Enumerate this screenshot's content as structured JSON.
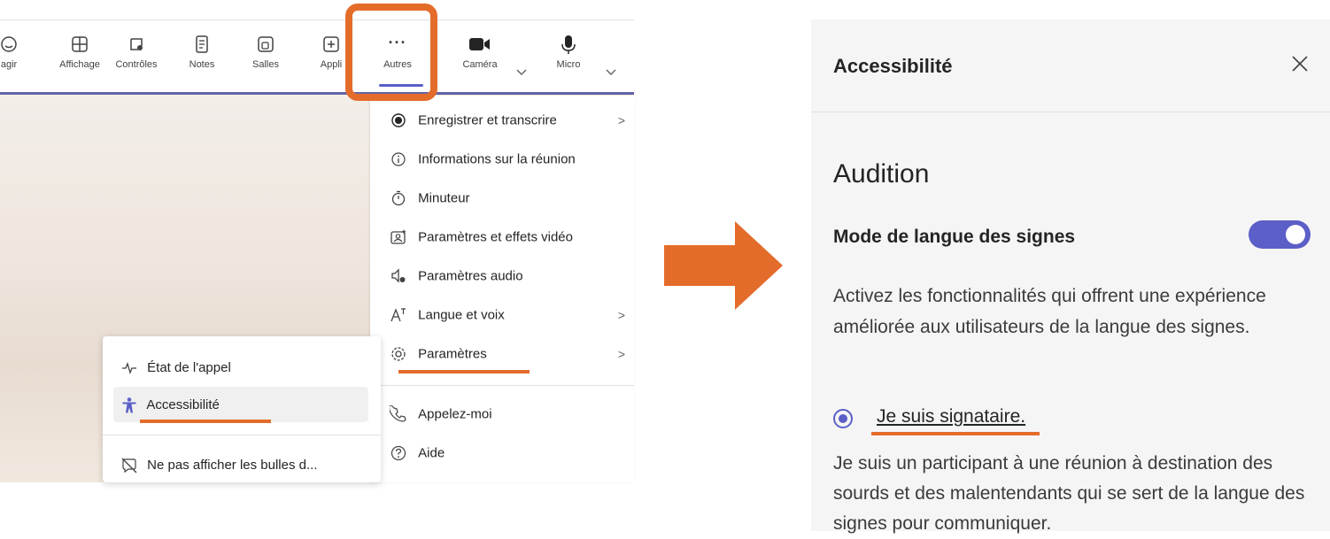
{
  "toolbar": {
    "items": [
      {
        "label": "agir",
        "icon": "react-icon"
      },
      {
        "label": "Affichage",
        "icon": "view-icon"
      },
      {
        "label": "Contrôles",
        "icon": "controls-icon"
      },
      {
        "label": "Notes",
        "icon": "notes-icon"
      },
      {
        "label": "Salles",
        "icon": "rooms-icon"
      },
      {
        "label": "Appli",
        "icon": "apps-icon"
      },
      {
        "label": "Autres",
        "icon": "more-icon"
      },
      {
        "label": "Caméra",
        "icon": "camera-icon"
      },
      {
        "label": "Micro",
        "icon": "microphone-icon"
      }
    ],
    "more_glyph": "···"
  },
  "more_menu": {
    "items": [
      {
        "label": "Enregistrer et transcrire",
        "icon": "record-icon",
        "has_submenu": true
      },
      {
        "label": "Informations sur la réunion",
        "icon": "info-icon",
        "has_submenu": false
      },
      {
        "label": "Minuteur",
        "icon": "timer-icon",
        "has_submenu": false
      },
      {
        "label": "Paramètres et effets vidéo",
        "icon": "video-effects-icon",
        "has_submenu": false
      },
      {
        "label": "Paramètres audio",
        "icon": "audio-settings-icon",
        "has_submenu": false
      },
      {
        "label": "Langue et voix",
        "icon": "language-icon",
        "has_submenu": true
      },
      {
        "label": "Paramètres",
        "icon": "gear-icon",
        "has_submenu": true
      },
      {
        "label": "Appelez-moi",
        "icon": "phone-icon",
        "has_submenu": false
      },
      {
        "label": "Aide",
        "icon": "help-icon",
        "has_submenu": false
      }
    ],
    "arrow_glyph": ">"
  },
  "settings_submenu": {
    "items": [
      {
        "label": "État de l'appel",
        "icon": "pulse-icon"
      },
      {
        "label": "Accessibilité",
        "icon": "accessibility-icon"
      },
      {
        "label": "Ne pas afficher les bulles d...",
        "icon": "hide-bubbles-icon"
      }
    ]
  },
  "accessibility_panel": {
    "title": "Accessibilité",
    "close_glyph": "✕",
    "section": "Audition",
    "toggle_label": "Mode de langue des signes",
    "toggle_on": true,
    "description": "Activez les fonctionnalités qui offrent une expérience améliorée aux utilisateurs de la langue des signes.",
    "radio_label": "Je suis signataire.",
    "radio_selected": true,
    "radio_description": "Je suis un participant à une réunion à destination des sourds et des malentendants qui se sert de la langue des signes pour communiquer."
  },
  "colors": {
    "accent": "#5b5fc7",
    "annotation_orange": "#e46c2b",
    "teams_purple_underline": "#6264a7"
  }
}
